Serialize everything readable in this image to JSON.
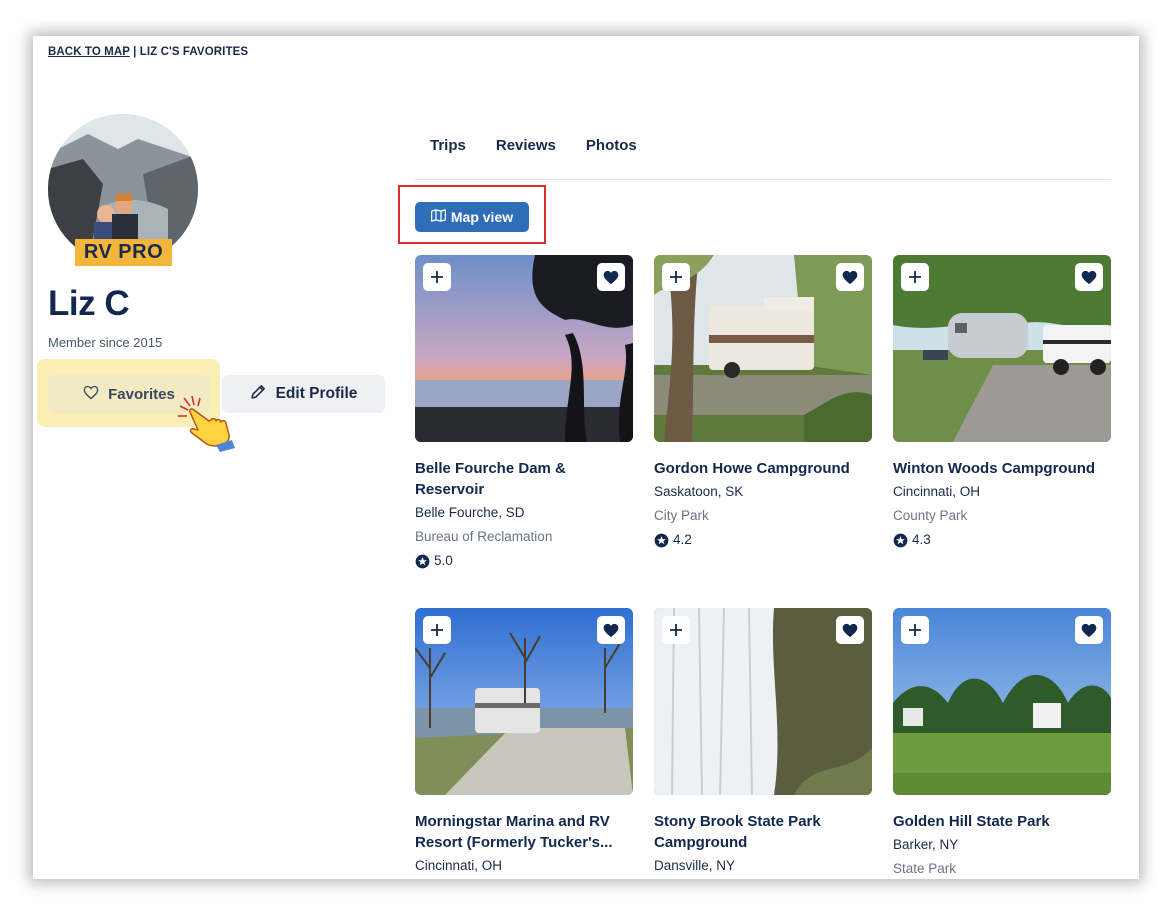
{
  "breadcrumb": {
    "back_link": "BACK TO MAP",
    "separator": " | ",
    "current": "LIZ C'S FAVORITES"
  },
  "profile": {
    "badge": "RV PRO",
    "name": "Liz C",
    "member_since": "Member since 2015",
    "favorites_label": "Favorites",
    "edit_profile_label": "Edit Profile"
  },
  "tabs": [
    {
      "label": "Trips"
    },
    {
      "label": "Reviews"
    },
    {
      "label": "Photos"
    }
  ],
  "map_view_label": "Map view",
  "colors": {
    "accent": "#2e6db8",
    "navy": "#13284e",
    "badge": "#f3b63b",
    "highlight": "#fbefb6",
    "annotation": "#d62f2f"
  },
  "cards": [
    {
      "title": "Belle Fourche Dam & Reservoir",
      "location": "Belle Fourche, SD",
      "type": "Bureau of Reclamation",
      "rating": "5.0"
    },
    {
      "title": "Gordon Howe Campground",
      "location": "Saskatoon, SK",
      "type": "City Park",
      "rating": "4.2"
    },
    {
      "title": "Winton Woods Campground",
      "location": "Cincinnati, OH",
      "type": "County Park",
      "rating": "4.3"
    },
    {
      "title": "Morningstar Marina and RV Resort (Formerly Tucker's...",
      "location": "Cincinnati, OH",
      "type": "",
      "rating": ""
    },
    {
      "title": "Stony Brook State Park Campground",
      "location": "Dansville, NY",
      "type": "",
      "rating": ""
    },
    {
      "title": "Golden Hill State Park",
      "location": "Barker, NY",
      "type": "State Park",
      "rating": ""
    }
  ]
}
